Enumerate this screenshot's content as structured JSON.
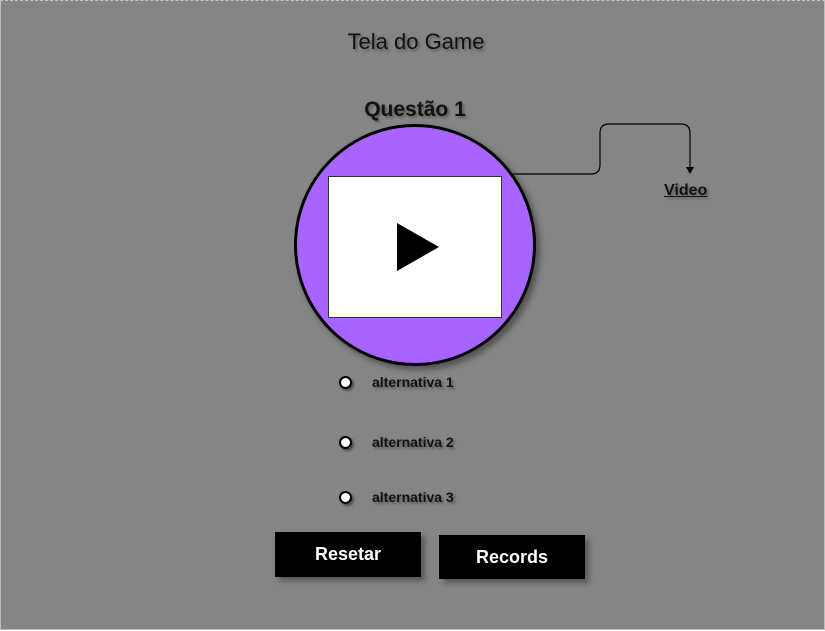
{
  "screen": {
    "title": "Tela do Game"
  },
  "question": {
    "label": "Questão 1"
  },
  "media": {
    "video_label": "Video",
    "circle_color": "#a864ff",
    "play_icon": "play-icon"
  },
  "options": [
    {
      "label": "alternativa 1"
    },
    {
      "label": "alternativa 2"
    },
    {
      "label": "alternativa 3"
    }
  ],
  "buttons": {
    "reset_label": "Resetar",
    "records_label": "Records"
  }
}
